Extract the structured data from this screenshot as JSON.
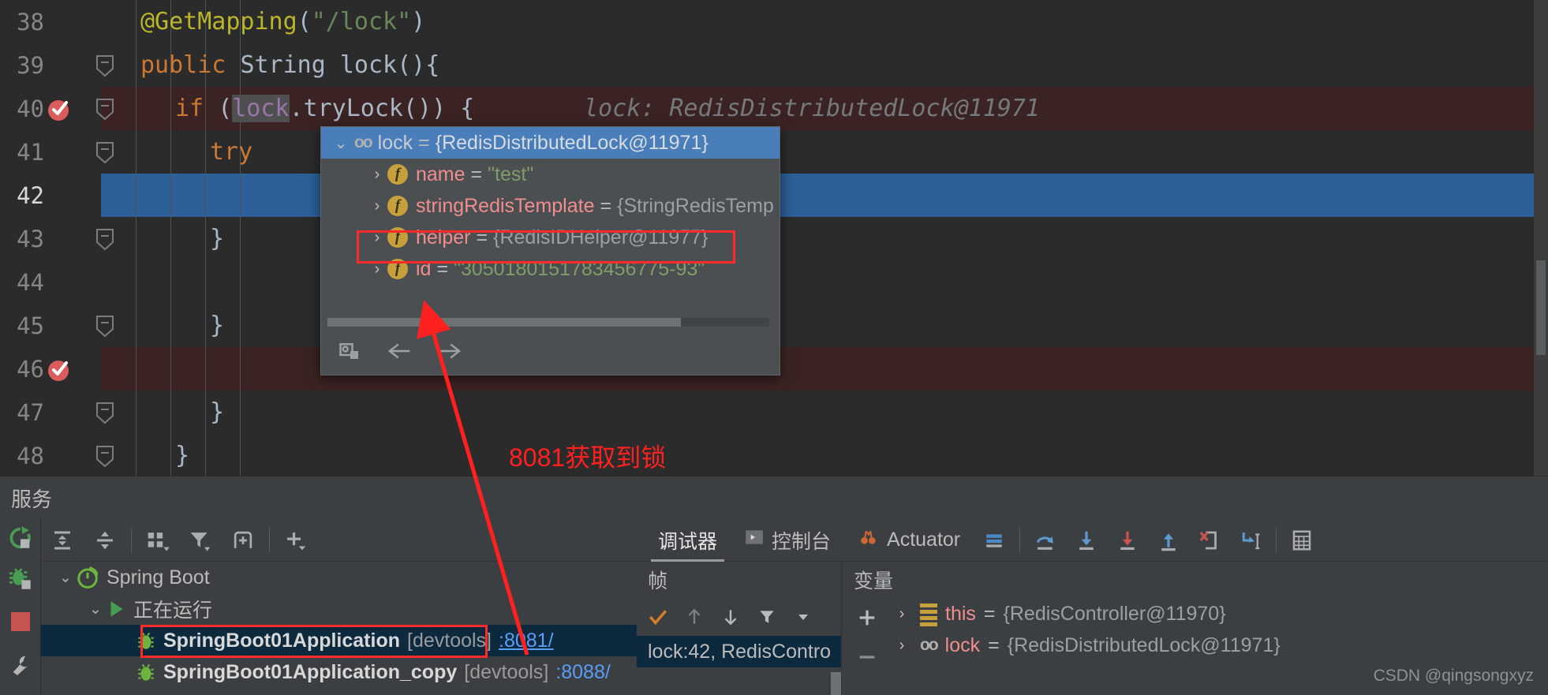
{
  "editor": {
    "lines": [
      {
        "num": "38",
        "fold": false,
        "bg": "none",
        "tokens": [
          {
            "t": "@GetMapping",
            "c": "ann"
          },
          {
            "t": "(",
            "c": "pln"
          },
          {
            "t": "\"/lock\"",
            "c": "str"
          },
          {
            "t": ")",
            "c": "pln"
          }
        ],
        "indent": 1
      },
      {
        "num": "39",
        "fold": true,
        "bg": "none",
        "tokens": [
          {
            "t": "public ",
            "c": "kw"
          },
          {
            "t": "String ",
            "c": "cls"
          },
          {
            "t": "lock",
            "c": "pln"
          },
          {
            "t": "(){",
            "c": "pln"
          }
        ],
        "indent": 1
      },
      {
        "num": "40",
        "fold": true,
        "bg": "breakpoint",
        "breakpoint": true,
        "tokens": [
          {
            "t": "if ",
            "c": "kw"
          },
          {
            "t": "(",
            "c": "pln"
          },
          {
            "t": "lock",
            "c": "fld",
            "boxed": true
          },
          {
            "t": ".tryLock()) {",
            "c": "pln"
          }
        ],
        "hint": "lock: RedisDistributedLock@11971",
        "indent": 2
      },
      {
        "num": "41",
        "fold": true,
        "bg": "none",
        "tokens": [
          {
            "t": "try",
            "c": "kw"
          }
        ],
        "indent": 3
      },
      {
        "num": "42",
        "fold": false,
        "bg": "selected",
        "current": true,
        "tokens": [],
        "indent": 4
      },
      {
        "num": "43",
        "fold": true,
        "bg": "none",
        "tokens": [
          {
            "t": "}",
            "c": "pln"
          }
        ],
        "indent": 3
      },
      {
        "num": "44",
        "fold": false,
        "bg": "none",
        "tokens": [],
        "indent": 3
      },
      {
        "num": "45",
        "fold": true,
        "bg": "none",
        "tokens": [
          {
            "t": "}",
            "c": "pln"
          }
        ],
        "indent": 3
      },
      {
        "num": "46",
        "fold": false,
        "bg": "breakpoint",
        "breakpoint": true,
        "tokens": [],
        "indent": 3
      },
      {
        "num": "47",
        "fold": true,
        "bg": "none",
        "tokens": [
          {
            "t": "}",
            "c": "pln"
          }
        ],
        "indent": 3
      },
      {
        "num": "48",
        "fold": true,
        "bg": "none",
        "tokens": [
          {
            "t": "}",
            "c": "pln"
          }
        ],
        "indent": 2
      }
    ]
  },
  "popup": {
    "root": {
      "name": "lock",
      "eq": "=",
      "value": "{RedisDistributedLock@11971}",
      "icon": "oo-icon"
    },
    "fields": [
      {
        "name": "name",
        "eq": "=",
        "value": "\"test\"",
        "value_style": "green"
      },
      {
        "name": "stringRedisTemplate",
        "eq": "=",
        "value": "{StringRedisTemp",
        "value_style": "grey"
      },
      {
        "name": "helper",
        "eq": "=",
        "value": "{RedisIDHelper@11977}",
        "value_style": "grey"
      },
      {
        "name": "id",
        "eq": "=",
        "value": "\"3050180151783456775-93\"",
        "value_style": "green",
        "highlighted": true
      }
    ]
  },
  "services": {
    "title": "服务",
    "toolbar_icons": [
      "expand-all-icon",
      "collapse-all-icon",
      "group-by-icon",
      "filter-icon",
      "add-tab-icon",
      "add-service-icon"
    ],
    "left_strip_icons": [
      "rerun-icon",
      "debug-icon",
      "stop-icon",
      "settings-icon"
    ],
    "tree": [
      {
        "level": 0,
        "caret": "⌄",
        "icon": "spring-boot-icon",
        "label": "Spring Boot"
      },
      {
        "level": 1,
        "caret": "⌄",
        "icon": "run-icon",
        "label": "正在运行"
      },
      {
        "level": 2,
        "caret": "",
        "icon": "bug-icon",
        "label": "SpringBoot01Application",
        "suffix": "[devtools]",
        "port": ":8081/",
        "selected": true,
        "highlighted": true
      },
      {
        "level": 2,
        "caret": "",
        "icon": "bug-icon",
        "label": "SpringBoot01Application_copy",
        "suffix": "[devtools]",
        "port": ":8088/",
        "selected": false
      }
    ]
  },
  "debugger": {
    "tabs": [
      {
        "label": "调试器",
        "icon": "",
        "active": true
      },
      {
        "label": "控制台",
        "icon": "console-icon",
        "active": false
      },
      {
        "label": "Actuator",
        "icon": "actuator-icon",
        "active": false
      }
    ],
    "toolbar_icons": [
      "layout-icon",
      "step-over-icon",
      "step-into-icon",
      "force-step-into-icon",
      "step-out-icon",
      "drop-frame-icon",
      "run-to-cursor-icon",
      "evaluate-icon"
    ],
    "frames": {
      "title": "帧",
      "toolbar_icons": [
        "thread-check-icon",
        "up-arrow-icon",
        "down-arrow-icon",
        "filter-icon",
        "dropdown-icon"
      ],
      "items": [
        {
          "label": "lock:42, RedisContro",
          "selected": true
        }
      ]
    },
    "variables": {
      "title": "变量",
      "buttons": [
        "add-watch-icon",
        "remove-watch-icon"
      ],
      "items": [
        {
          "name": "this",
          "eq": "=",
          "value": "{RedisController@11970}",
          "icon": "list-icon"
        },
        {
          "name": "lock",
          "eq": "=",
          "value": "{RedisDistributedLock@11971}",
          "icon": "oo-icon"
        }
      ]
    }
  },
  "annotation": {
    "text": "8081获取到锁",
    "color": "#ff2020"
  },
  "watermark": "CSDN @qingsongxyz",
  "colors": {
    "editor_bg": "#2b2b2b",
    "panel_bg": "#3c3f41",
    "selection_blue": "#2d6099",
    "breakpoint_red": "#3b2323",
    "popup_bg": "#4b4f52",
    "popup_sel": "#4a7ebb",
    "tree_sel": "#0d293e",
    "annotation_red": "#ff2b2b"
  }
}
